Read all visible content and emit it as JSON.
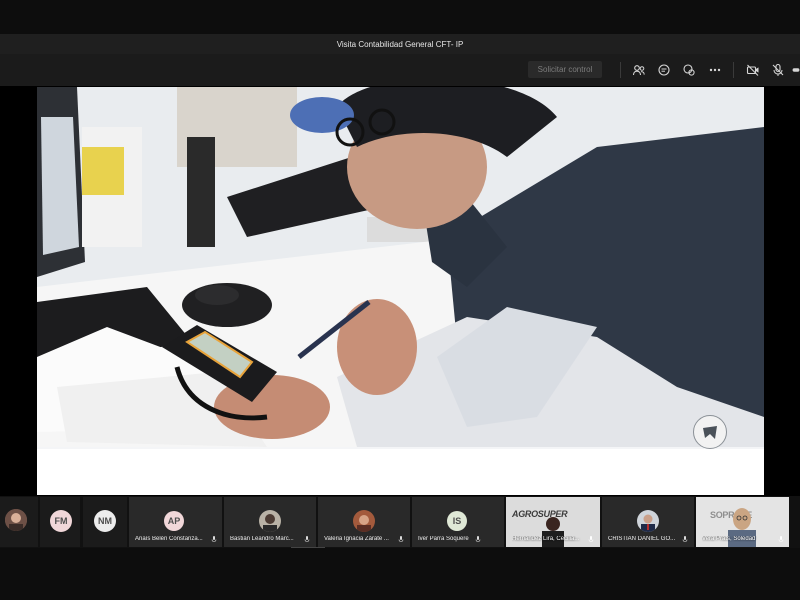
{
  "window": {
    "title": "Visita Contabilidad General CFT- IP"
  },
  "toolbar": {
    "request_control_label": "Solicitar control",
    "icons": [
      "people-icon",
      "chat-icon",
      "reactions-icon",
      "more-icon",
      "camera-off-icon",
      "mic-off-icon"
    ]
  },
  "shared_content": {
    "kind": "photo",
    "description_icons": [
      "logo-badge-icon"
    ]
  },
  "participants": [
    {
      "name": "",
      "initials": "",
      "kind": "photo"
    },
    {
      "name": "",
      "initials": "FM",
      "kind": "initials"
    },
    {
      "name": "",
      "initials": "NM",
      "kind": "initials"
    },
    {
      "name": "Anaís Belén Constanza...",
      "initials": "AP",
      "kind": "initials"
    },
    {
      "name": "Bastián Leandro Marc...",
      "initials": "",
      "kind": "photo"
    },
    {
      "name": "Valeria Ignacia Zárate ...",
      "initials": "",
      "kind": "photo"
    },
    {
      "name": "Iver Parra Soquere",
      "initials": "IS",
      "kind": "initials"
    },
    {
      "name": "Hernández Lira, Cecilia...",
      "initials": "",
      "kind": "video",
      "banner": "AGROSUPER"
    },
    {
      "name": "CRISTIAN DANIEL GO...",
      "initials": "",
      "kind": "photo"
    },
    {
      "name": "Vera Prats, Soledad",
      "initials": "",
      "kind": "video",
      "banner": "SOPROLE"
    }
  ],
  "colors": {
    "avatar_bg": "#f1d7d9",
    "accent_orange": "#e8a33a",
    "avatar_is": "#dfe8d6"
  }
}
